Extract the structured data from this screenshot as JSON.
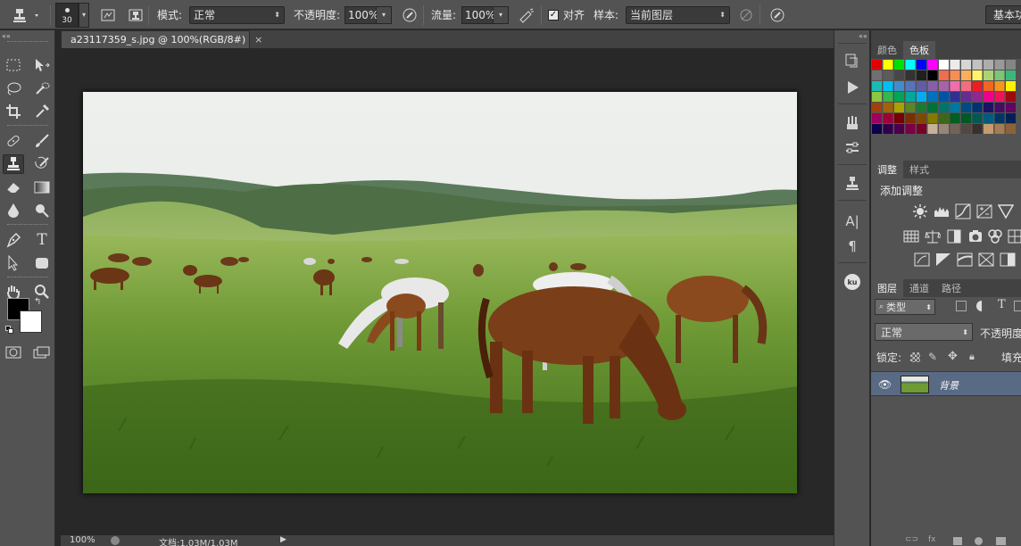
{
  "options_bar": {
    "brush_size": "30",
    "mode_label": "模式:",
    "mode_value": "正常",
    "opacity_label": "不透明度:",
    "opacity_value": "100%",
    "flow_label": "流量:",
    "flow_value": "100%",
    "align_label": "对齐",
    "align_checked": true,
    "sample_label": "样本:",
    "sample_value": "当前图层",
    "workspace_button": "基本功"
  },
  "document": {
    "tab_title": "a23117359_s.jpg @ 100%(RGB/8#)",
    "close_glyph": "×",
    "zoom": "100%",
    "doc_info": "文档:1.03M/1.03M"
  },
  "tools": {
    "foreground_color": "#000000",
    "background_color": "#ffffff",
    "active_tool": "clone-stamp"
  },
  "swatches_panel": {
    "tabs": [
      "颜色",
      "色板"
    ],
    "active_tab": 1
  },
  "adjustments_panel": {
    "tabs": [
      "调整",
      "样式"
    ],
    "heading": "添加调整"
  },
  "layers_panel": {
    "tabs": [
      "图层",
      "通道",
      "路径"
    ],
    "filter_label": "类型",
    "blend_mode": "正常",
    "opacity_label": "不透明度",
    "lock_label": "锁定:",
    "fill_label": "填充",
    "layers": [
      {
        "name": "背景",
        "visible": true
      }
    ]
  },
  "colors": {
    "ui_panel": "#535353",
    "ui_dark": "#282828",
    "layer_selected": "#596a84"
  }
}
